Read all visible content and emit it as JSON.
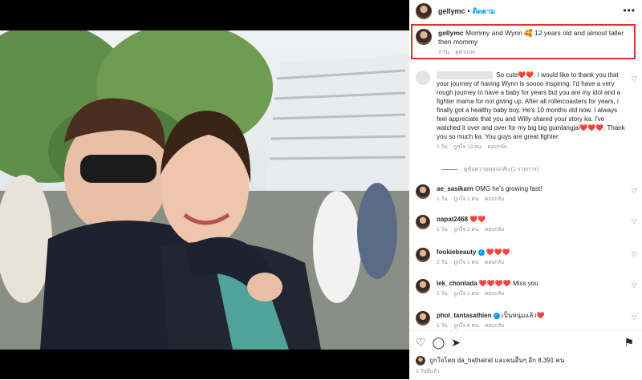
{
  "post": {
    "username": "gellymc",
    "follow_label": "ติดตาม",
    "more_label": "•••",
    "caption_text": "Mommy and Wynn 🥰 12 years old and almost taller then mommy",
    "caption_meta": [
      "2 วัน",
      "ดูคำแปล"
    ]
  },
  "comments": [
    {
      "username": "",
      "text": "So cute❤️❤️. I would like to thank you that your journey of having Wynn is soooo inspiring. I'd have a very rough journey to have a baby for years but you are my idol and a fighter mama for not giving up. After all rollercoasters for years, i finally got a healthy baby boy. He's 10 months old now. I always feel appreciate that you and Willy shared your story ka. I've watched it over and over for my big big gumlangjai❤️❤️❤️. Thank you so much ka. You guys are great fighter",
      "meta": [
        "2 วัน",
        "ถูกใจ 13 คน",
        "ตอบกลับ"
      ]
    },
    {
      "username": "ae_sasikarn",
      "text": "OMG he's growing fast!",
      "meta": [
        "1 วัน",
        "ถูกใจ 1 คน",
        "ตอบกลับ"
      ]
    },
    {
      "username": "napat2468",
      "text": "❤️❤️",
      "meta": [
        "1 วัน",
        "ถูกใจ 2 คน",
        "ตอบกลับ"
      ]
    },
    {
      "username": "fookiebeauty",
      "text": "❤️❤️❤️",
      "meta": [
        "2 วัน",
        "ถูกใจ 1 คน",
        "ตอบกลับ"
      ]
    },
    {
      "username": "lek_chonlada",
      "text": "❤️❤️❤️❤️ Miss you",
      "meta": [
        "2 วัน",
        "ถูกใจ 1 คน",
        "ตอบกลับ"
      ]
    },
    {
      "username": "phol_tantasathien",
      "text": "เป็นหนุ่มแล้ว❤️",
      "meta": [
        "1 วัน",
        "ถูกใจ 6 คน",
        "ตอบกลับ"
      ]
    }
  ],
  "view_replies": "ดูข้อความตอบกลับ (1 รายการ)",
  "footer": {
    "likes_text": "ถูกใจโดย da_hathairat และคนอื่นๆ อีก 8,391 คน",
    "time_ago": "2 วันที่แล้ว"
  },
  "icons": [
    "heart-icon",
    "comment-icon",
    "share-icon",
    "save-icon",
    "verified-icon"
  ],
  "colors": {
    "accent": "#0095f6",
    "highlight": "#e0302e",
    "heart": "#ed4956"
  }
}
